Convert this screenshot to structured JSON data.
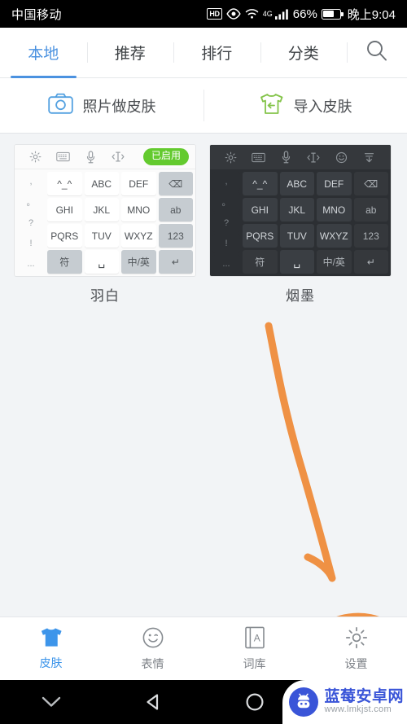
{
  "status_bar": {
    "carrier": "中国移动",
    "hd_badge": "HD",
    "network": "4G",
    "battery_percent": "66%",
    "time": "晚上9:04"
  },
  "top_tabs": {
    "items": [
      {
        "label": "本地",
        "active": true
      },
      {
        "label": "推荐",
        "active": false
      },
      {
        "label": "排行",
        "active": false
      },
      {
        "label": "分类",
        "active": false
      }
    ],
    "search_icon": "search-icon",
    "active_color": "#4b92e0"
  },
  "action_bar": {
    "items": [
      {
        "label": "照片做皮肤",
        "icon": "camera-icon",
        "color": "#52a0e0"
      },
      {
        "label": "导入皮肤",
        "icon": "tshirt-import-icon",
        "color": "#84c44a"
      }
    ]
  },
  "skins": [
    {
      "name": "羽白",
      "theme": "light",
      "badge": "已启用",
      "badge_color": "#63ca2e",
      "toolbar_icons": [
        "gear-icon",
        "keyboard-icon",
        "microphone-icon",
        "cursor-move-icon"
      ],
      "left_keys": [
        ",",
        "。",
        "?",
        "!",
        "..."
      ],
      "grid_keys": [
        {
          "label": "^_^",
          "type": "normal"
        },
        {
          "label": "ABC",
          "type": "normal"
        },
        {
          "label": "DEF",
          "type": "normal"
        },
        {
          "label": "⌫",
          "type": "fn"
        },
        {
          "label": "GHI",
          "type": "normal"
        },
        {
          "label": "JKL",
          "type": "normal"
        },
        {
          "label": "MNO",
          "type": "normal"
        },
        {
          "label": "ab",
          "type": "fn"
        },
        {
          "label": "PQRS",
          "type": "normal"
        },
        {
          "label": "TUV",
          "type": "normal"
        },
        {
          "label": "WXYZ",
          "type": "normal"
        },
        {
          "label": "123",
          "type": "fn"
        },
        {
          "label": "符",
          "type": "fn"
        },
        {
          "label": "␣",
          "type": "normal"
        },
        {
          "label": "中/英",
          "type": "fn"
        },
        {
          "label": "↵",
          "type": "fn"
        }
      ]
    },
    {
      "name": "烟墨",
      "theme": "dark",
      "badge": "",
      "toolbar_icons": [
        "gear-icon",
        "keyboard-icon",
        "microphone-icon",
        "cursor-move-icon",
        "emoji-icon",
        "collapse-down-icon"
      ],
      "left_keys": [
        ",",
        "。",
        "?",
        "!",
        "..."
      ],
      "grid_keys": [
        {
          "label": "^_^",
          "type": "normal"
        },
        {
          "label": "ABC",
          "type": "normal"
        },
        {
          "label": "DEF",
          "type": "normal"
        },
        {
          "label": "⌫",
          "type": "fn"
        },
        {
          "label": "GHI",
          "type": "normal"
        },
        {
          "label": "JKL",
          "type": "normal"
        },
        {
          "label": "MNO",
          "type": "normal"
        },
        {
          "label": "ab",
          "type": "fn"
        },
        {
          "label": "PQRS",
          "type": "normal"
        },
        {
          "label": "TUV",
          "type": "normal"
        },
        {
          "label": "WXYZ",
          "type": "normal"
        },
        {
          "label": "123",
          "type": "fn"
        },
        {
          "label": "符",
          "type": "fn"
        },
        {
          "label": "␣",
          "type": "normal"
        },
        {
          "label": "中/英",
          "type": "fn"
        },
        {
          "label": "↵",
          "type": "fn"
        }
      ]
    }
  ],
  "annotations": {
    "color": "#ef9144",
    "arrow": "curved-arrow-pointing-to-settings",
    "circle": "ellipse-around-settings-tab"
  },
  "bottom_nav": {
    "items": [
      {
        "label": "皮肤",
        "icon": "tshirt-icon",
        "active": true
      },
      {
        "label": "表情",
        "icon": "smiley-icon",
        "active": false
      },
      {
        "label": "词库",
        "icon": "dictionary-icon",
        "active": false
      },
      {
        "label": "设置",
        "icon": "gear-icon",
        "active": false
      }
    ],
    "active_color": "#3d95ea"
  },
  "system_bar": {
    "buttons": [
      "chevron-down-icon",
      "back-icon",
      "home-icon"
    ]
  },
  "watermark": {
    "title": "蓝莓安卓网",
    "url": "www.lmkjst.com"
  }
}
